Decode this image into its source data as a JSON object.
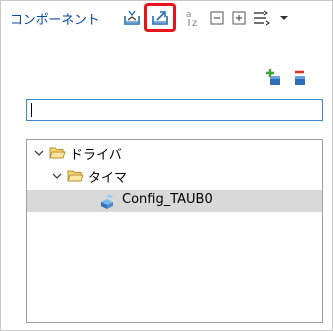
{
  "panel": {
    "title": "コンポーネント"
  },
  "toolbar": {
    "buttons": [
      {
        "name": "import-icon"
      },
      {
        "name": "export-icon"
      },
      {
        "name": "sort-alpha-icon"
      },
      {
        "name": "collapse-all-icon"
      },
      {
        "name": "expand-all-icon"
      },
      {
        "name": "view-menu-icon"
      }
    ],
    "highlighted": "export-icon",
    "highlight_color": "#e8141c"
  },
  "actions": {
    "add": {
      "name": "add-component-icon"
    },
    "remove": {
      "name": "remove-component-icon"
    }
  },
  "search": {
    "value": "",
    "placeholder": ""
  },
  "tree": {
    "nodes": [
      {
        "label": "ドライバ",
        "icon": "folder-icon",
        "expanded": true
      },
      {
        "label": "タイマ",
        "icon": "folder-icon",
        "expanded": true
      },
      {
        "label": "Config_TAUB0",
        "icon": "component-icon",
        "selected": true
      }
    ]
  }
}
